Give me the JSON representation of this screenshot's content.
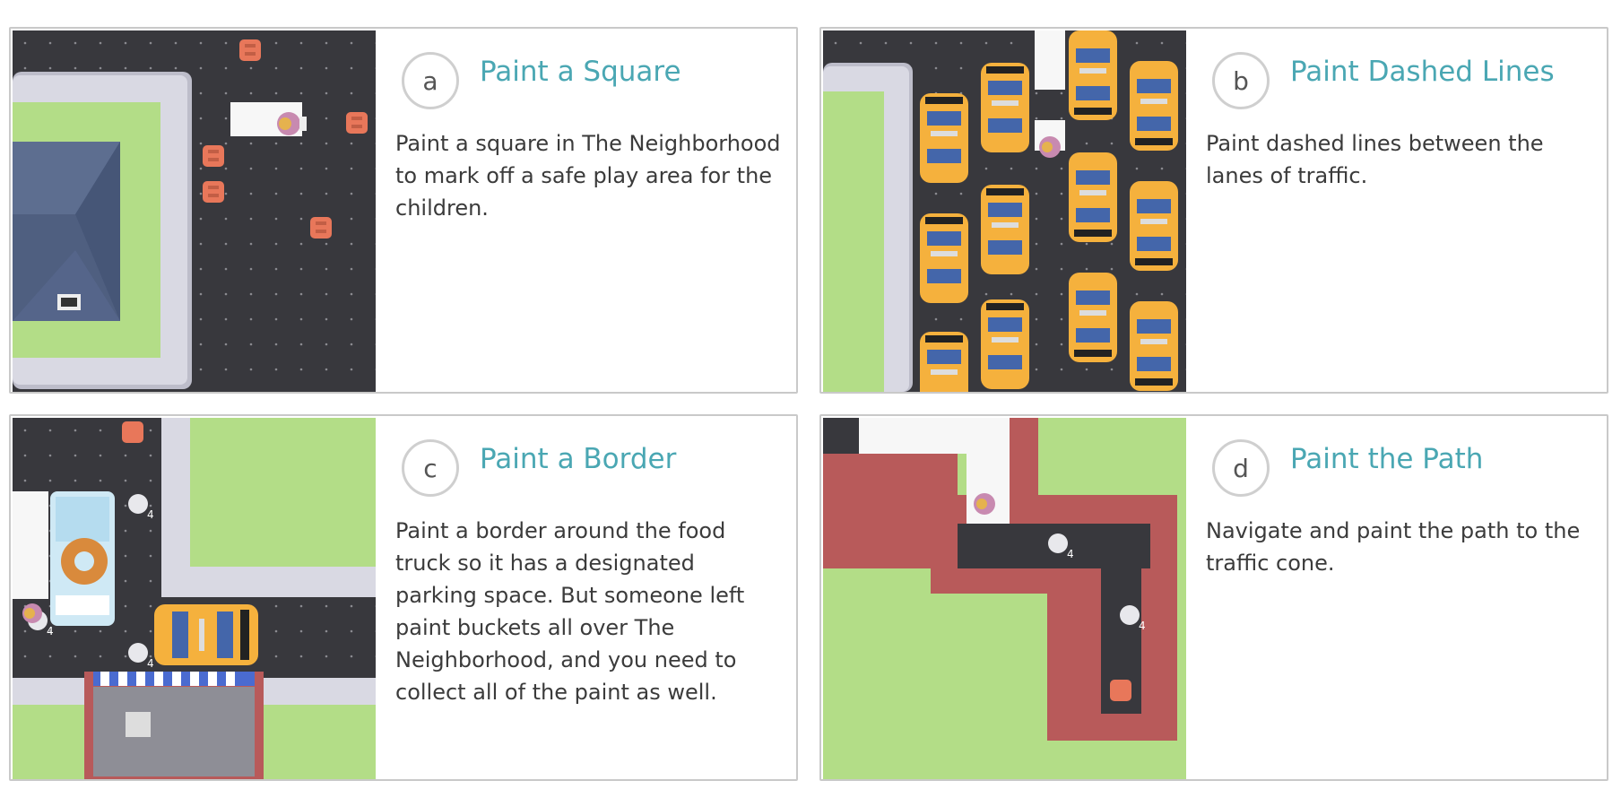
{
  "cards": [
    {
      "letter": "a",
      "title": "Paint a Square",
      "description": "Paint a square in The Neighborhood to mark off a safe play area for the children.",
      "bucket_label": ""
    },
    {
      "letter": "b",
      "title": "Paint Dashed Lines",
      "description": "Paint dashed lines between the lanes of traffic.",
      "bucket_label": ""
    },
    {
      "letter": "c",
      "title": "Paint a Border",
      "description": "Paint a border around the food truck so it has a designated parking space. But someone left paint buckets all over The Neighborhood, and you need to collect all of the paint as well.",
      "bucket_label": "4"
    },
    {
      "letter": "d",
      "title": "Paint the Path",
      "description": "Navigate and paint the path to the traffic cone.",
      "bucket_label": "4"
    }
  ],
  "colors": {
    "accent": "#4aa7b3",
    "road": "#3a3a3f",
    "grass": "#b9e38c",
    "sidewalk": "#d8d8e2",
    "brick": "#b85a5a",
    "taxi": "#f5b13d",
    "cone": "#e8775a"
  }
}
